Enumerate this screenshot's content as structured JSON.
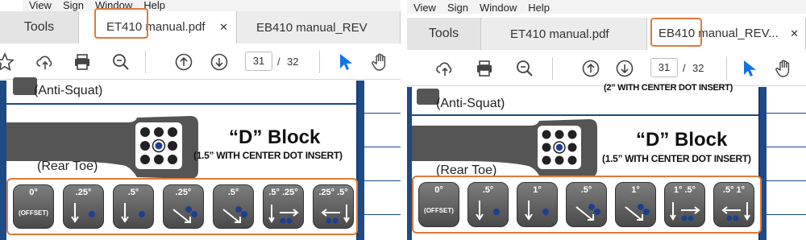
{
  "left": {
    "menu": [
      "View",
      "Sign",
      "Window",
      "Help"
    ],
    "tabs": {
      "tools": "Tools",
      "doc1": "ET410 manual.pdf",
      "doc2": "EB410 manual_REV"
    },
    "page": {
      "current": "31",
      "separator": "/",
      "total": "32"
    },
    "doc": {
      "anti_squat": "(Anti-Squat)",
      "rear_toe": "(Rear Toe)",
      "block_title": "“D” Block",
      "block_sub": "(1.5” WITH CENTER DOT INSERT)"
    },
    "buttons": [
      {
        "label": "0°",
        "label2": "(OFFSET)",
        "icon": "offset"
      },
      {
        "label": ".25°",
        "icon": "down-arrow"
      },
      {
        "label": ".5°",
        "icon": "down-arrow"
      },
      {
        "label": ".25°",
        "icon": "diagonal-arrow"
      },
      {
        "label": ".5°",
        "icon": "diagonal-arrow"
      },
      {
        "label": ".5° .25°",
        "icon": "down-right-arrows"
      },
      {
        "label": ".25° .5°",
        "icon": "left-down-arrows"
      }
    ]
  },
  "right": {
    "menu": [
      "View",
      "Sign",
      "Window",
      "Help"
    ],
    "tabs": {
      "tools": "Tools",
      "doc1": "ET410 manual.pdf",
      "doc2": "EB410 manual_REV..."
    },
    "page": {
      "current": "31",
      "separator": "/",
      "total": "32"
    },
    "doc": {
      "top_note": "(2” WITH CENTER DOT INSERT)",
      "anti_squat": "(Anti-Squat)",
      "rear_toe": "(Rear Toe)",
      "block_title": "“D” Block",
      "block_sub": "(1.5” WITH CENTER DOT INSERT)"
    },
    "buttons": [
      {
        "label": "0°",
        "label2": "(OFFSET)",
        "icon": "offset"
      },
      {
        "label": ".5°",
        "icon": "down-arrow"
      },
      {
        "label": "1°",
        "icon": "down-arrow"
      },
      {
        "label": ".5°",
        "icon": "diagonal-arrow"
      },
      {
        "label": "1°",
        "icon": "diagonal-arrow"
      },
      {
        "label": "1° .5°",
        "icon": "down-right-arrows"
      },
      {
        "label": ".5° 1°",
        "icon": "left-down-arrows"
      }
    ]
  },
  "colors": {
    "highlight": "#e07a3a",
    "doc_blue": "#1e4a86",
    "pointer_blue": "#1473e6",
    "dot_blue": "#1d3f8f"
  },
  "icons": [
    "star-icon",
    "upload-icon",
    "print-icon",
    "zoom-icon",
    "page-up-icon",
    "page-down-icon",
    "select-cursor-icon",
    "hand-tool-icon",
    "close-icon"
  ]
}
